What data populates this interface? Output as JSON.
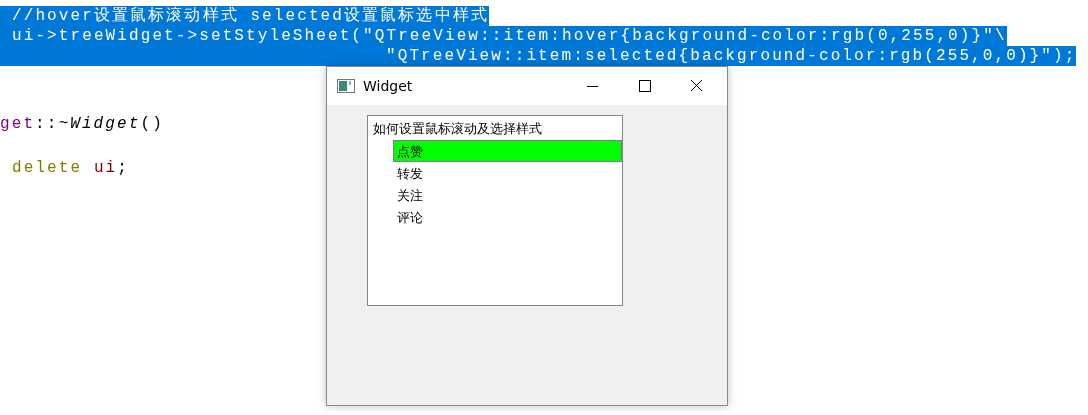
{
  "editor": {
    "lines": [
      {
        "kind": "code",
        "selected": true,
        "segments": [
          {
            "kind": "plain",
            "text": "//hover设置鼠标滚动样式 selected设置鼠标选中样式"
          }
        ]
      },
      {
        "kind": "code",
        "selected": true,
        "segments": [
          {
            "kind": "plain",
            "text": "ui->treeWidget->setStyleSheet(\"QTreeView::item:hover{background-color:rgb(0,255,0)}\"\\"
          }
        ]
      },
      {
        "kind": "continuation",
        "selected": true,
        "segments": [
          {
            "kind": "plain",
            "text": "\"QTreeView::item:selected{background-color:rgb(255,0,0)}\");"
          }
        ]
      },
      {
        "kind": "blank"
      },
      {
        "kind": "blank"
      },
      {
        "kind": "code",
        "selected": false,
        "segments": [
          {
            "kind": "type",
            "text": "get"
          },
          {
            "kind": "plain",
            "text": "::"
          },
          {
            "kind": "italic",
            "text": "~Widget"
          },
          {
            "kind": "plain",
            "text": "()"
          }
        ]
      },
      {
        "kind": "blank"
      },
      {
        "kind": "body",
        "selected": false,
        "segments": [
          {
            "kind": "keyword",
            "text": "delete"
          },
          {
            "kind": "member",
            "text": "ui"
          },
          {
            "kind": "plain",
            "text": ";"
          }
        ]
      }
    ]
  },
  "window": {
    "title": "Widget",
    "tree": {
      "label": "如何设置鼠标滚动及选择样式",
      "expanded": true,
      "children": [
        {
          "label": "点赞",
          "hovered": true
        },
        {
          "label": "转发",
          "hovered": false
        },
        {
          "label": "关注",
          "hovered": false
        },
        {
          "label": "评论",
          "hovered": false
        }
      ]
    }
  }
}
